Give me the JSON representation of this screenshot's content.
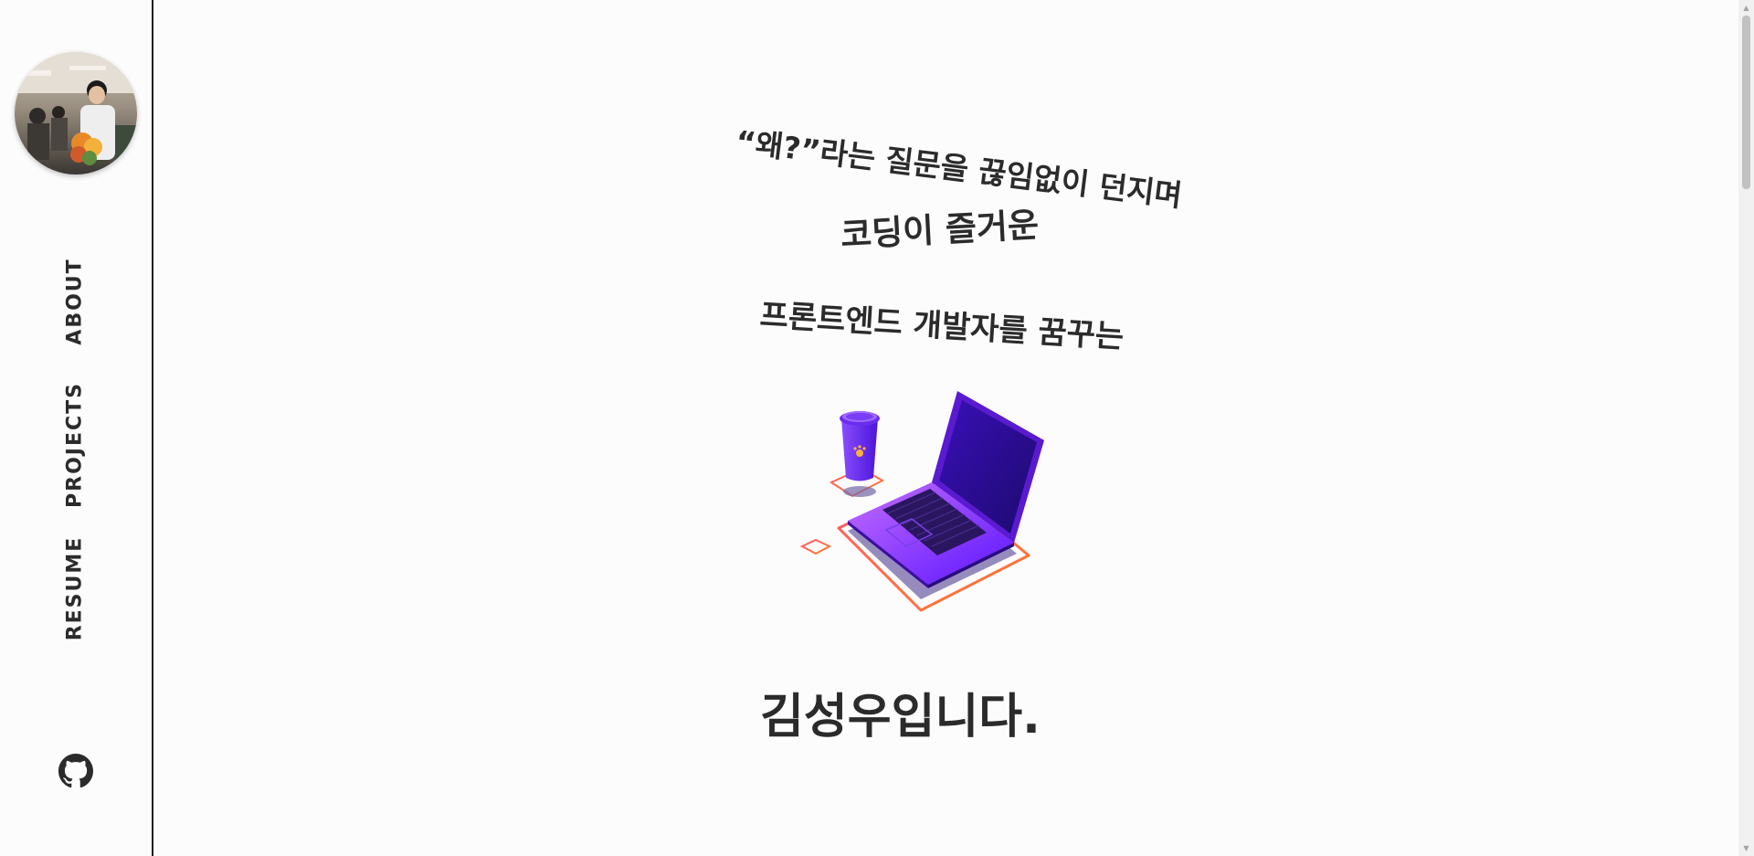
{
  "sidebar": {
    "avatar_alt": "profile photo",
    "nav": [
      {
        "label": "ABOUT"
      },
      {
        "label": "PROJECTS"
      },
      {
        "label": "RESUME"
      }
    ],
    "github_icon": "github-icon"
  },
  "hero": {
    "line1": "“왜?”라는 질문을 끊임없이 던지며",
    "line2": "코딩이 즐거운",
    "line3": "프론트엔드 개발자를 꿈꾸는",
    "name": "김성우입니다.",
    "illustration_icon": "laptop-coffee-illustration"
  },
  "scrollbar": {
    "up_arrow": "▲",
    "down_arrow": "▼"
  },
  "colors": {
    "background": "#fdfcfc",
    "text": "#2b2b2b",
    "accent_purple": "#6a1bff",
    "accent_orange": "#ff6a3d"
  }
}
